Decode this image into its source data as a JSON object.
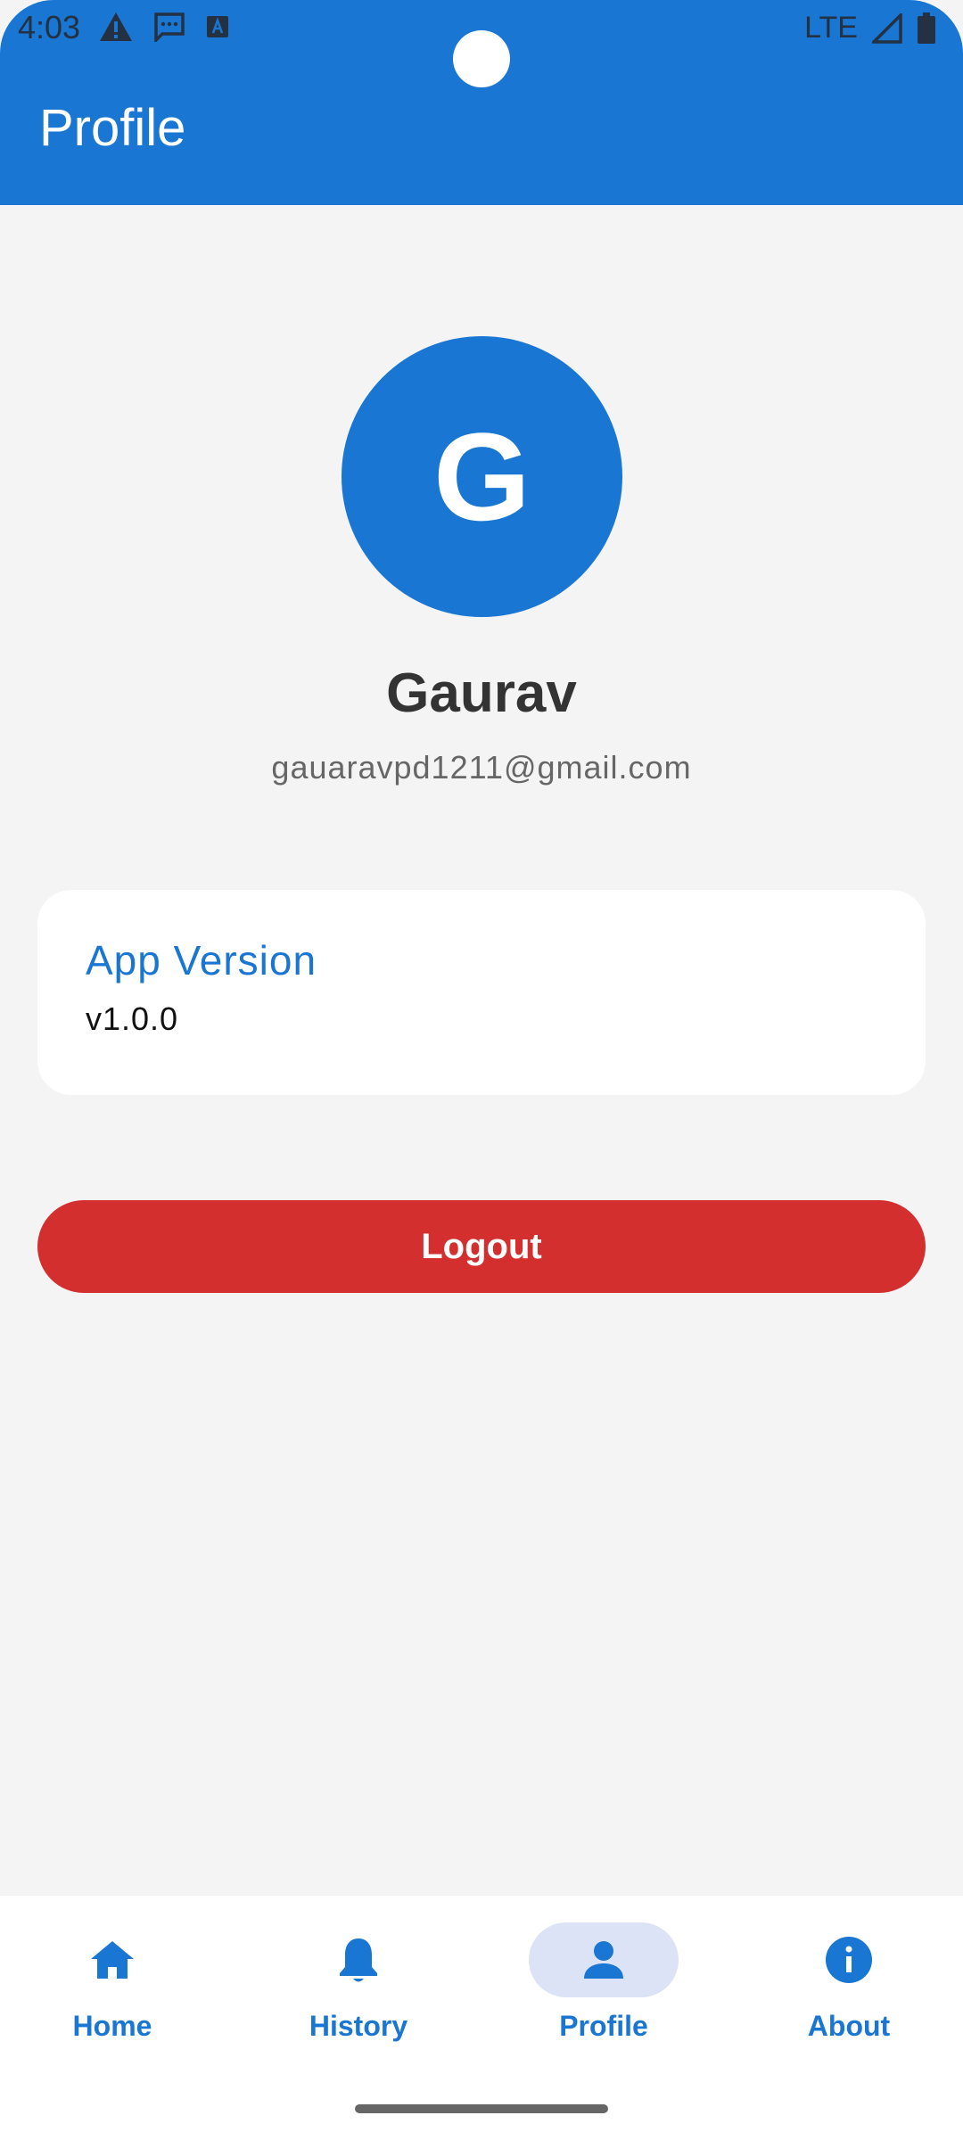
{
  "status_bar": {
    "time": "4:03",
    "network": "LTE",
    "icons_left": [
      "warning-icon",
      "message-icon",
      "keyboard-a-icon"
    ],
    "icons_right": [
      "signal-icon",
      "battery-icon"
    ]
  },
  "app_bar": {
    "title": "Profile"
  },
  "profile": {
    "initial": "G",
    "name": "Gaurav",
    "email": "gauaravpd1211@gmail.com"
  },
  "version_card": {
    "label": "App Version",
    "value": "v1.0.0"
  },
  "logout_label": "Logout",
  "bottom_nav": {
    "items": [
      {
        "label": "Home",
        "icon": "home-icon",
        "active": false
      },
      {
        "label": "History",
        "icon": "bell-icon",
        "active": false
      },
      {
        "label": "Profile",
        "icon": "person-icon",
        "active": true
      },
      {
        "label": "About",
        "icon": "info-icon",
        "active": false
      }
    ]
  },
  "colors": {
    "primary": "#1976d2",
    "danger": "#d32f2f",
    "background": "#f4f4f4",
    "nav_active_pill": "#dde3f6"
  }
}
